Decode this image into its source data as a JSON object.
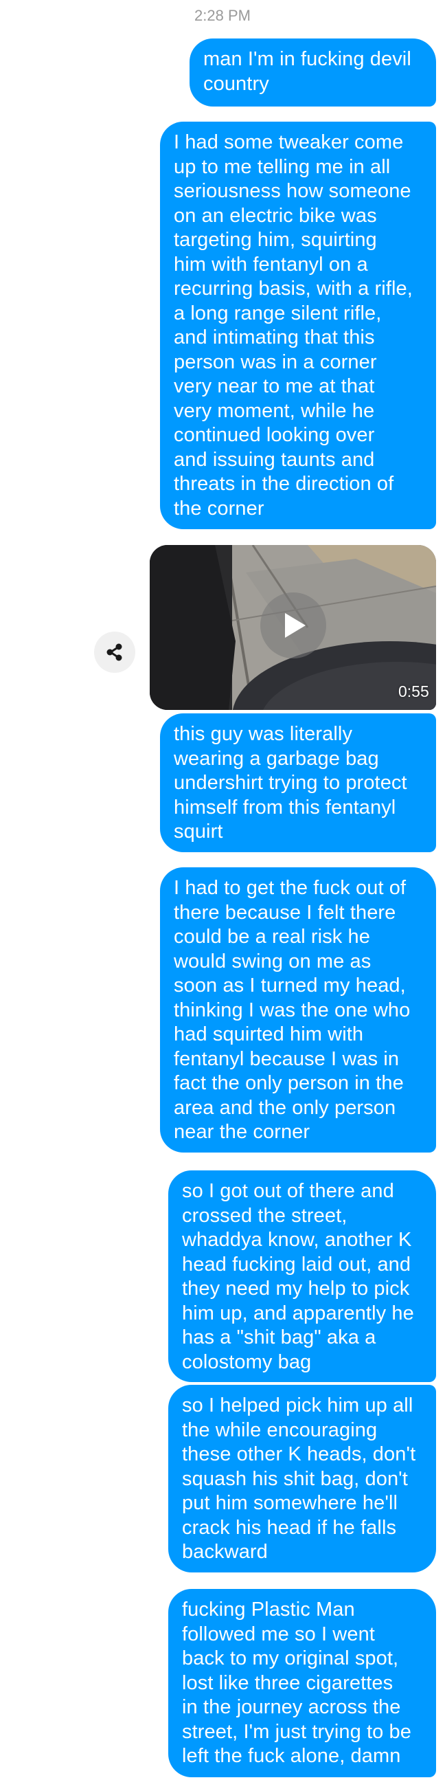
{
  "conversation": {
    "timestamp": "2:28 PM",
    "messages": [
      {
        "text": "man I'm in fucking devil\ncountry"
      },
      {
        "text": "I had some tweaker come\nup to me telling me in all\nseriousness how someone\non an electric bike was\ntargeting him, squirting\nhim with fentanyl on a\nrecurring basis, with a rifle,\na long range silent rifle,\nand intimating that this\nperson was in a corner\nvery near to me at that\nvery moment, while he\ncontinued looking over\nand issuing taunts and\nthreats in the direction of\nthe corner"
      },
      {
        "text": "this guy was literally\nwearing a garbage bag\nundershirt trying to protect\nhimself from this fentanyl\nsquirt"
      },
      {
        "text": "I had to get the fuck out of\nthere because I felt there\ncould be a real risk he\nwould swing on me as\nsoon as I turned my head,\nthinking I was the one who\nhad squirted him with\nfentanyl because I was in\nfact the only person in the\narea and the only person\nnear the corner"
      },
      {
        "text": "so I got out of there and\ncrossed the street,\nwhaddya know, another K\nhead fucking laid out, and\nthey need my help to pick\nhim up, and apparently he\nhas a \"shit bag\" aka a\ncolostomy bag"
      },
      {
        "text": "so I helped pick him up all\nthe while encouraging\nthese other K heads, don't\nsquash his shit bag, don't\nput him somewhere he'll\ncrack his head if he falls\nbackward"
      },
      {
        "text": "fucking Plastic Man\nfollowed me so I went\nback to my original spot,\nlost like three cigarettes\nin the journey across the\nstreet, I'm just trying to be\nleft the fuck alone, damn"
      }
    ],
    "video": {
      "duration": "0:55",
      "play_icon": "play-icon",
      "share_icon": "share-icon"
    }
  },
  "colors": {
    "bubble": "#0099ff",
    "bubble_text": "#ffffff",
    "timestamp": "#9a9a9a",
    "background": "#ffffff"
  }
}
